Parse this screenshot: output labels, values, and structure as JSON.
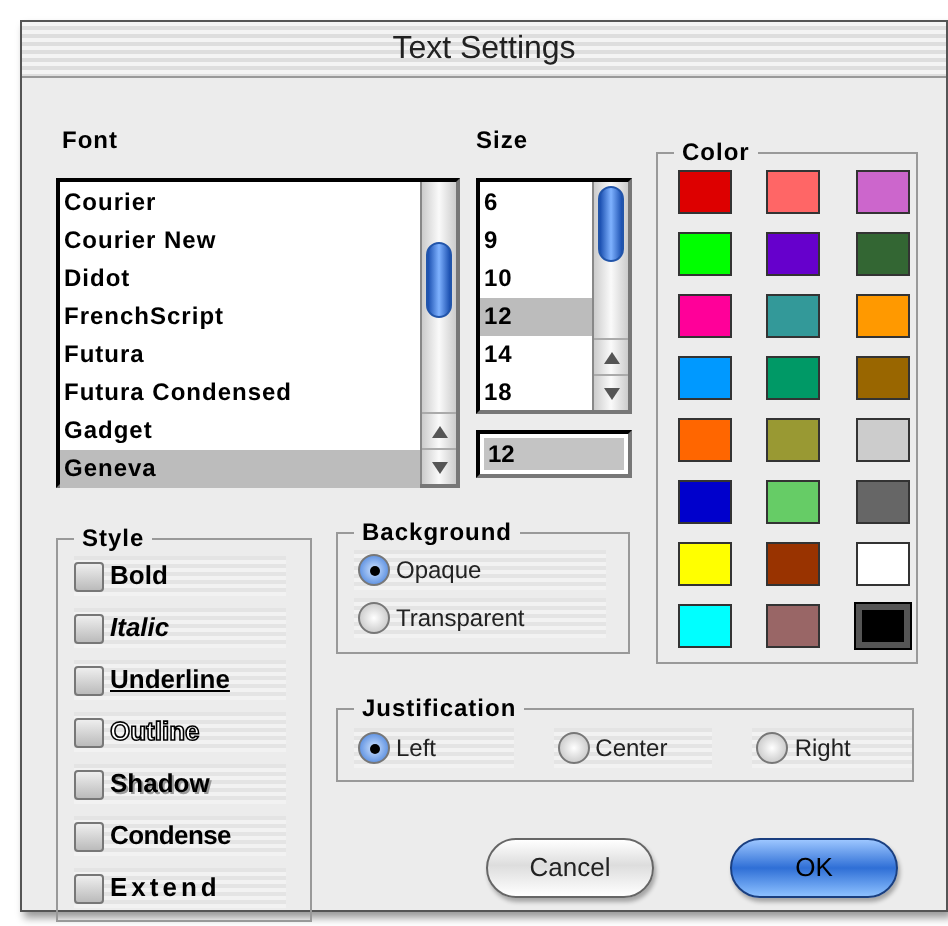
{
  "window": {
    "title": "Text Settings"
  },
  "font": {
    "label": "Font",
    "items": [
      {
        "label": "Courier",
        "selected": false
      },
      {
        "label": "Courier New",
        "selected": false
      },
      {
        "label": "Didot",
        "selected": false
      },
      {
        "label": "FrenchScript",
        "selected": false
      },
      {
        "label": "Futura",
        "selected": false
      },
      {
        "label": "Futura Condensed",
        "selected": false
      },
      {
        "label": "Gadget",
        "selected": false
      },
      {
        "label": "Geneva",
        "selected": true
      }
    ]
  },
  "size": {
    "label": "Size",
    "items": [
      {
        "label": "6",
        "selected": false
      },
      {
        "label": "9",
        "selected": false
      },
      {
        "label": "10",
        "selected": false
      },
      {
        "label": "12",
        "selected": true
      },
      {
        "label": "14",
        "selected": false
      },
      {
        "label": "18",
        "selected": false
      }
    ],
    "value": "12"
  },
  "color": {
    "label": "Color",
    "swatches": [
      {
        "color": "#dd0000",
        "selected": false
      },
      {
        "color": "#ff6666",
        "selected": false
      },
      {
        "color": "#cc66cc",
        "selected": false
      },
      {
        "color": "#00ff00",
        "selected": false
      },
      {
        "color": "#6600cc",
        "selected": false
      },
      {
        "color": "#336633",
        "selected": false
      },
      {
        "color": "#ff0099",
        "selected": false
      },
      {
        "color": "#339999",
        "selected": false
      },
      {
        "color": "#ff9900",
        "selected": false
      },
      {
        "color": "#0099ff",
        "selected": false
      },
      {
        "color": "#009966",
        "selected": false
      },
      {
        "color": "#996600",
        "selected": false
      },
      {
        "color": "#ff6600",
        "selected": false
      },
      {
        "color": "#999933",
        "selected": false
      },
      {
        "color": "#cccccc",
        "selected": false
      },
      {
        "color": "#0000cc",
        "selected": false
      },
      {
        "color": "#66cc66",
        "selected": false
      },
      {
        "color": "#666666",
        "selected": false
      },
      {
        "color": "#ffff00",
        "selected": false
      },
      {
        "color": "#993300",
        "selected": false
      },
      {
        "color": "#ffffff",
        "selected": false
      },
      {
        "color": "#00ffff",
        "selected": false
      },
      {
        "color": "#996666",
        "selected": false
      },
      {
        "color": "#000000",
        "selected": true
      }
    ]
  },
  "style": {
    "label": "Style",
    "options": [
      {
        "label": "Bold",
        "kind": "bold",
        "checked": false
      },
      {
        "label": "Italic",
        "kind": "italic",
        "checked": false
      },
      {
        "label": "Underline",
        "kind": "underline",
        "checked": false
      },
      {
        "label": "Outline",
        "kind": "outline",
        "checked": false
      },
      {
        "label": "Shadow",
        "kind": "shadow",
        "checked": false
      },
      {
        "label": "Condense",
        "kind": "condense",
        "checked": false
      },
      {
        "label": "Extend",
        "kind": "extend",
        "checked": false
      }
    ]
  },
  "background": {
    "label": "Background",
    "options": [
      {
        "label": "Opaque",
        "selected": true
      },
      {
        "label": "Transparent",
        "selected": false
      }
    ]
  },
  "justification": {
    "label": "Justification",
    "options": [
      {
        "label": "Left",
        "selected": true
      },
      {
        "label": "Center",
        "selected": false
      },
      {
        "label": "Right",
        "selected": false
      }
    ]
  },
  "buttons": [
    {
      "label": "Cancel",
      "kind": "normal"
    },
    {
      "label": "OK",
      "kind": "default"
    }
  ]
}
